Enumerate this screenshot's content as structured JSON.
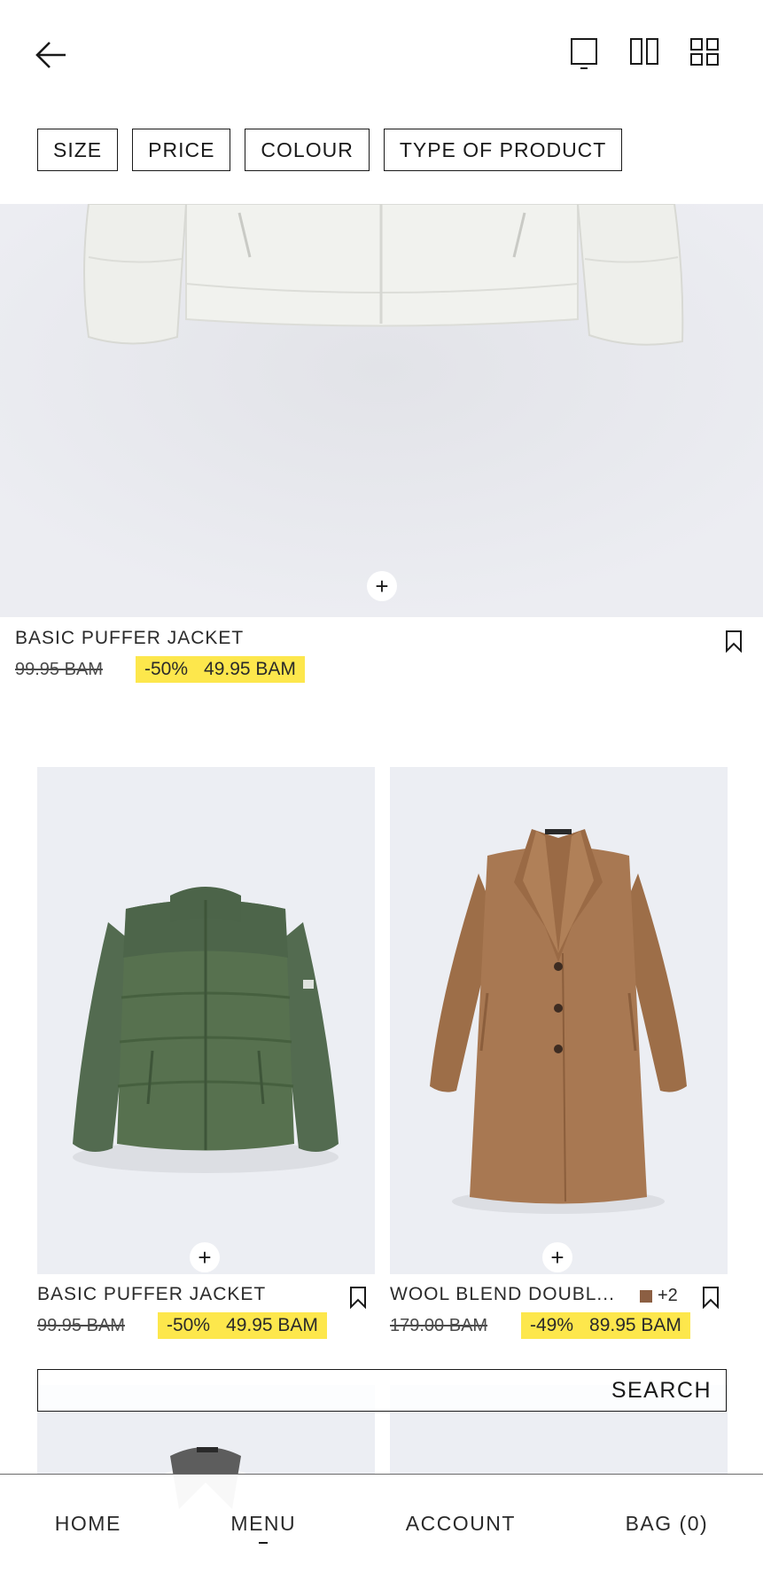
{
  "header": {
    "back_icon": "arrow-left-icon",
    "view_icons": [
      "single-view-icon",
      "double-view-icon",
      "grid-view-icon"
    ]
  },
  "filters": [
    "SIZE",
    "PRICE",
    "COLOUR",
    "TYPE OF PRODUCT"
  ],
  "hero_product": {
    "name": "BASIC PUFFER JACKET",
    "old_price": "99.95 BAM",
    "discount": "-50%",
    "new_price": "49.95 BAM",
    "add_icon": "+",
    "color": "#f2f3ef"
  },
  "grid_products": [
    {
      "name": "BASIC PUFFER JACKET",
      "old_price": "99.95 BAM",
      "discount": "-50%",
      "new_price": "49.95 BAM",
      "add_icon": "+",
      "color": "#556f52"
    },
    {
      "name": "WOOL BLEND DOUBL...",
      "old_price": "179.00 BAM",
      "discount": "-49%",
      "new_price": "89.95 BAM",
      "add_icon": "+",
      "more_colours": "+2",
      "swatch_color": "#8c5f43",
      "color": "#a67650"
    }
  ],
  "search": {
    "label": "SEARCH"
  },
  "bottom_nav": {
    "home": "HOME",
    "menu": "MENU",
    "account": "ACCOUNT",
    "bag": "BAG (0)"
  },
  "colors": {
    "sale_highlight": "#fde74c",
    "image_bg": "#eceef3"
  }
}
